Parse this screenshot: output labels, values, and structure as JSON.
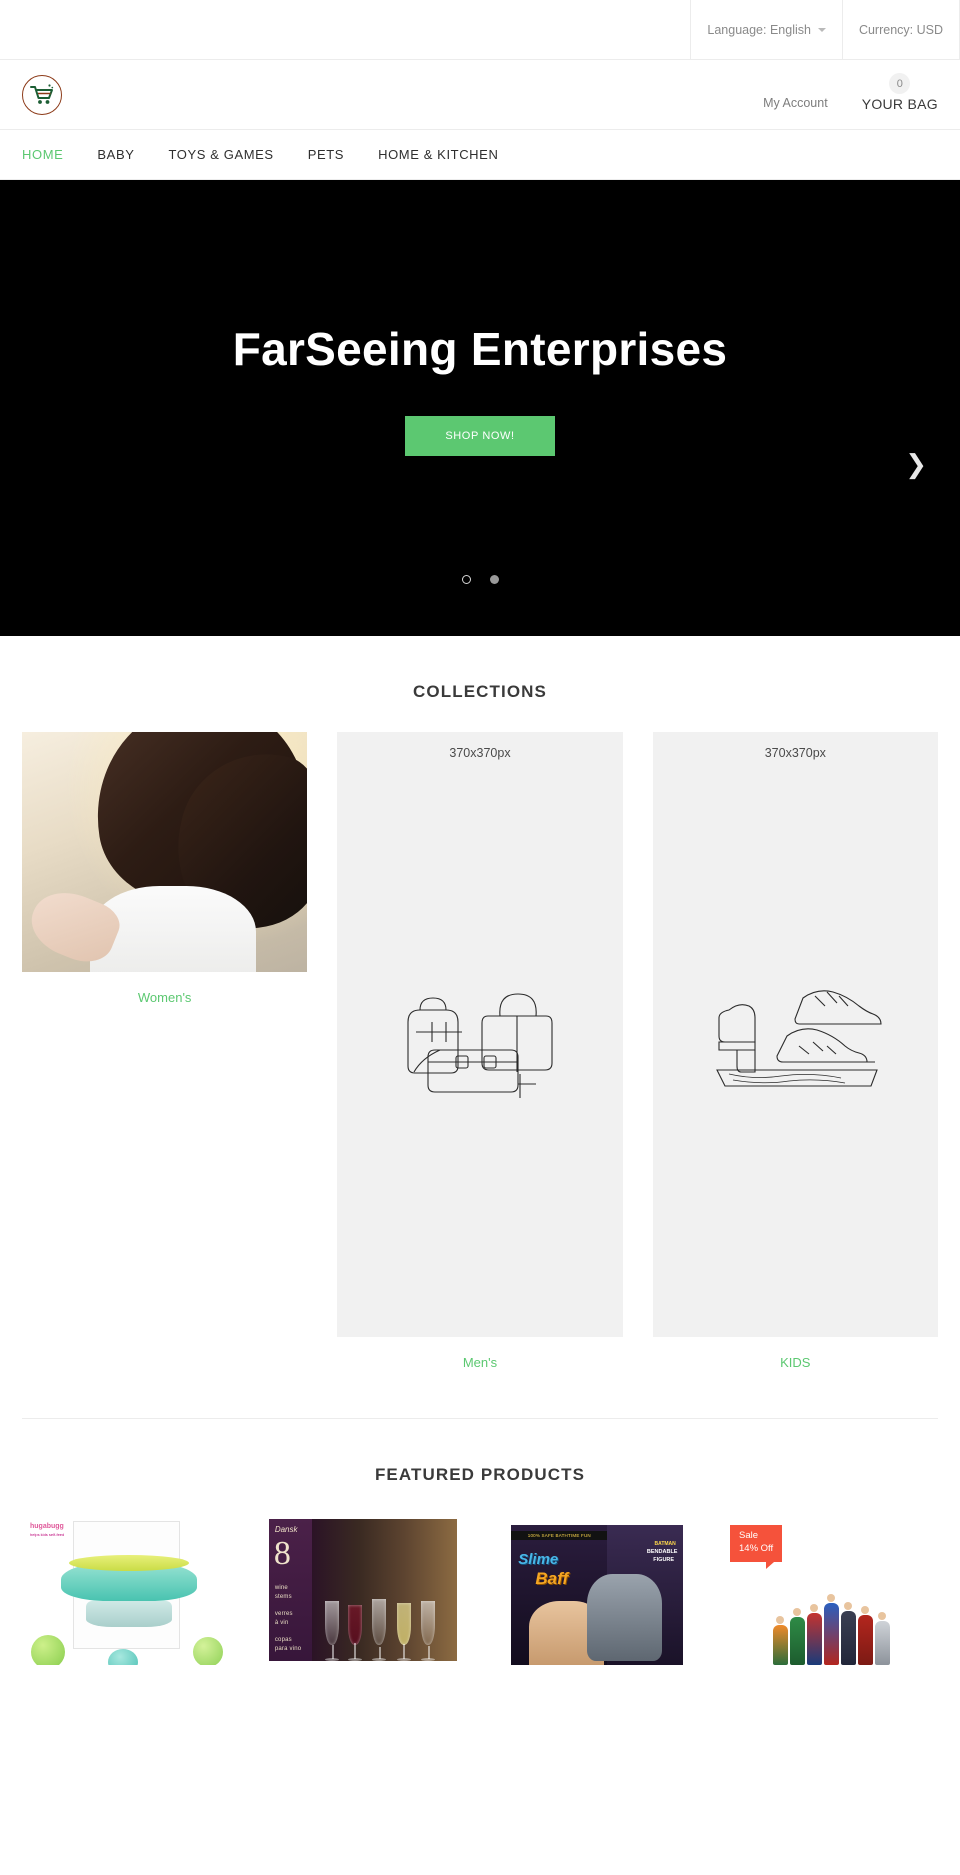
{
  "topbar": {
    "language": "Language: English",
    "currency": "Currency: USD"
  },
  "header": {
    "logo_name": "shopping-cart-logo",
    "my_account": "My Account",
    "bag_count": "0",
    "bag_label": "YOUR BAG"
  },
  "nav": {
    "items": [
      {
        "label": "HOME",
        "active": true
      },
      {
        "label": "BABY",
        "active": false
      },
      {
        "label": "TOYS & GAMES",
        "active": false
      },
      {
        "label": "PETS",
        "active": false
      },
      {
        "label": "HOME & KITCHEN",
        "active": false
      }
    ]
  },
  "hero": {
    "title": "FarSeeing Enterprises",
    "button": "SHOP NOW!",
    "next_arrow_icon": "chevron-right-icon",
    "dots": [
      "hollow",
      "filled"
    ],
    "background_color": "#000000",
    "button_color": "#5cc871"
  },
  "collections": {
    "heading": "COLLECTIONS",
    "items": [
      {
        "caption": "Women's",
        "placeholder": ""
      },
      {
        "caption": "Men's",
        "placeholder": "370x370px"
      },
      {
        "caption": "KIDS",
        "placeholder": "370x370px"
      }
    ],
    "caption_color": "#5cc871"
  },
  "featured": {
    "heading": "FEATURED PRODUCTS",
    "products": [
      {
        "name": "hugabugg-baby-bowl",
        "brand": "hugabugg",
        "tagline": "helps kids self-feed",
        "sale_badge": null
      },
      {
        "name": "dansk-wine-stems",
        "brand": "Dansk",
        "count": "8",
        "lines": [
          "wine",
          "stems",
          "verres",
          "à vin",
          "copas",
          "para vino"
        ],
        "sale_badge": null
      },
      {
        "name": "slime-baff-batman-figure",
        "top_strip": "100% SAFE BATHTIME FUN",
        "title_line1": "Slime",
        "title_line2": "Baff",
        "side_label1": "BATMAN",
        "side_label2": "BENDABLE",
        "side_label3": "FIGURE",
        "sale_badge": null
      },
      {
        "name": "justice-league-figure-set",
        "sale_badge": {
          "line1": "Sale",
          "line2": "14% Off",
          "color": "#f5523b"
        }
      }
    ]
  }
}
